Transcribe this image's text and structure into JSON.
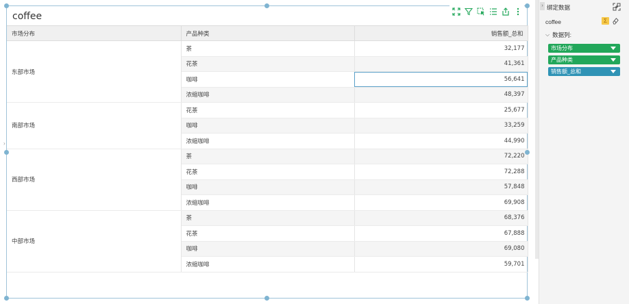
{
  "widget": {
    "title": "coffee",
    "table": {
      "headers": [
        "市场分布",
        "产品种类",
        "销售额_总和"
      ],
      "groups": [
        {
          "market": "东部市场",
          "rows": [
            {
              "product": "茶",
              "sales": "32,177"
            },
            {
              "product": "花茶",
              "sales": "41,361"
            },
            {
              "product": "咖啡",
              "sales": "56,641"
            },
            {
              "product": "浓缩咖啡",
              "sales": "48,397"
            }
          ]
        },
        {
          "market": "南部市场",
          "rows": [
            {
              "product": "花茶",
              "sales": "25,677"
            },
            {
              "product": "咖啡",
              "sales": "33,259"
            },
            {
              "product": "浓缩咖啡",
              "sales": "44,990"
            }
          ]
        },
        {
          "market": "西部市场",
          "rows": [
            {
              "product": "茶",
              "sales": "72,220"
            },
            {
              "product": "花茶",
              "sales": "72,288"
            },
            {
              "product": "咖啡",
              "sales": "57,848"
            },
            {
              "product": "浓缩咖啡",
              "sales": "69,908"
            }
          ]
        },
        {
          "market": "中部市场",
          "rows": [
            {
              "product": "茶",
              "sales": "68,376"
            },
            {
              "product": "花茶",
              "sales": "67,888"
            },
            {
              "product": "咖啡",
              "sales": "69,080"
            },
            {
              "product": "浓缩咖啡",
              "sales": "59,701"
            }
          ]
        }
      ],
      "selected_value": "56,641"
    },
    "toolbar_icons": [
      "fullscreen-icon",
      "filter-icon",
      "select-icon",
      "list-icon",
      "export-icon",
      "more-icon"
    ]
  },
  "panel": {
    "title": "绑定数据",
    "dataset": "coffee",
    "columns_label": "数据列:",
    "fields": [
      {
        "label": "市场分布",
        "color": "#22a75a"
      },
      {
        "label": "产品种类",
        "color": "#22a75a"
      },
      {
        "label": "销售额_总和",
        "color": "#2f93b5"
      }
    ],
    "sum_icon": "Σ"
  },
  "colors": {
    "accent_green": "#22a75a",
    "accent_blue": "#2f93b5",
    "selection": "#7fb4d1"
  }
}
